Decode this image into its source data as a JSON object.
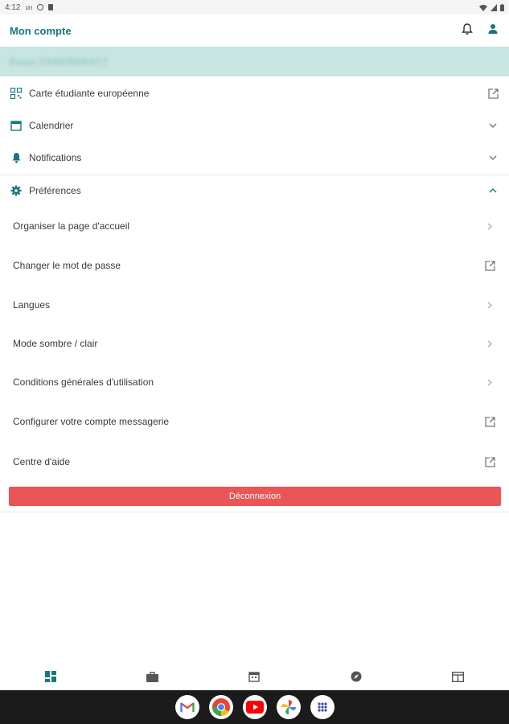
{
  "status_bar": {
    "time": "4:12",
    "ampm": "un"
  },
  "app_bar": {
    "title": "Mon compte"
  },
  "user": {
    "name": "Ewan PARENDRATT"
  },
  "menu": {
    "european_card": "Carte étudiante européenne",
    "calendar": "Calendrier",
    "notifications": "Notifications",
    "preferences": "Préférences"
  },
  "preferences_items": [
    {
      "label": "Organiser la page d'accueil",
      "icon": "chevron-right-icon"
    },
    {
      "label": "Changer le mot de passe",
      "icon": "external-link-icon"
    },
    {
      "label": "Langues",
      "icon": "chevron-right-icon"
    },
    {
      "label": "Mode sombre / clair",
      "icon": "chevron-right-icon"
    },
    {
      "label": "Conditions générales d'utilisation",
      "icon": "chevron-right-icon"
    },
    {
      "label": "Configurer votre compte messagerie",
      "icon": "external-link-icon"
    },
    {
      "label": "Centre d'aide",
      "icon": "external-link-icon"
    }
  ],
  "logout_label": "Déconnexion",
  "bottom_nav": [
    "dashboard-icon",
    "briefcase-icon",
    "calendar-icon",
    "compass-icon",
    "layout-icon"
  ],
  "dock_apps": [
    "gmail-icon",
    "chrome-icon",
    "youtube-icon",
    "photos-icon",
    "app-drawer-icon"
  ],
  "colors": {
    "accent": "#16787e",
    "band": "#c7e5e1",
    "logout": "#ea5556",
    "dock": "#1b1b1b"
  }
}
